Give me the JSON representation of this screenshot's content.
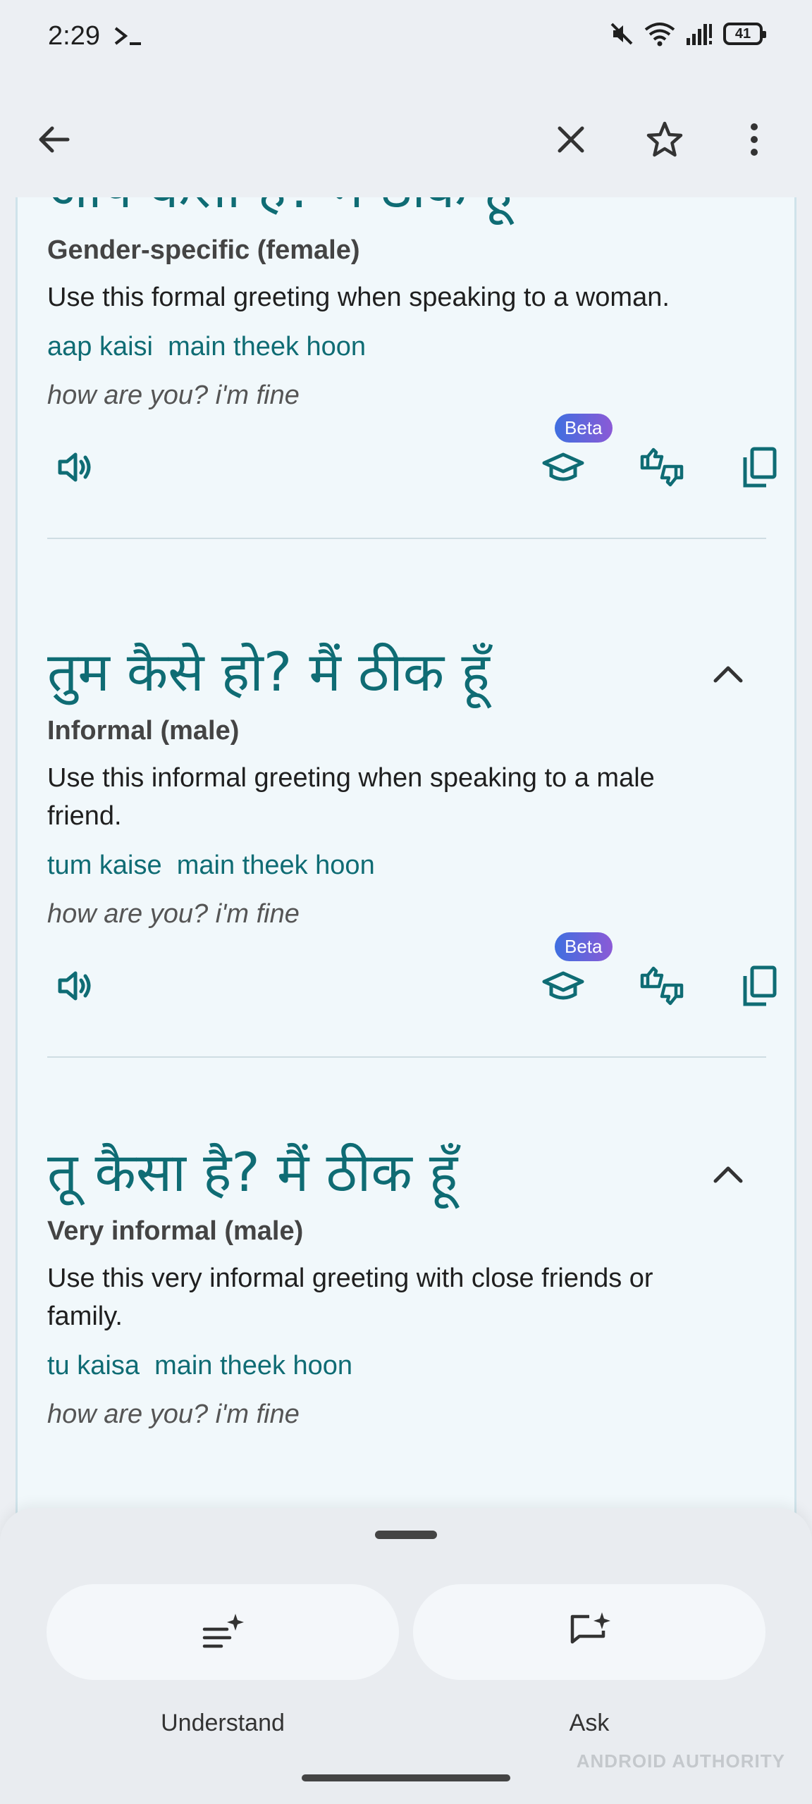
{
  "status": {
    "time": "2:29",
    "battery": "41"
  },
  "entries": [
    {
      "hindi": "आप कैसी हैं? मैं ठीक हूँ",
      "label": "Gender-specific (female)",
      "description": "Use this formal greeting when speaking to a woman.",
      "transliteration": "aap kaisi  main theek hoon",
      "english": "how are you? i'm fine",
      "beta": "Beta"
    },
    {
      "hindi": "तुम कैसे हो? मैं ठीक हूँ",
      "label": "Informal (male)",
      "description": "Use this informal greeting when speaking to a male friend.",
      "transliteration": "tum kaise  main theek hoon",
      "english": "how are you? i'm fine",
      "beta": "Beta"
    },
    {
      "hindi": "तू कैसा है? मैं ठीक हूँ",
      "label": "Very informal (male)",
      "description": "Use this very informal greeting with close friends or family.",
      "transliteration": "tu kaisa  main theek hoon",
      "english": "how are you? i'm fine"
    }
  ],
  "sheet": {
    "understand": "Understand",
    "ask": "Ask"
  },
  "watermark": "ANDROID AUTHORITY",
  "colors": {
    "accent": "#0f6c74",
    "background": "#f1f8fb"
  }
}
